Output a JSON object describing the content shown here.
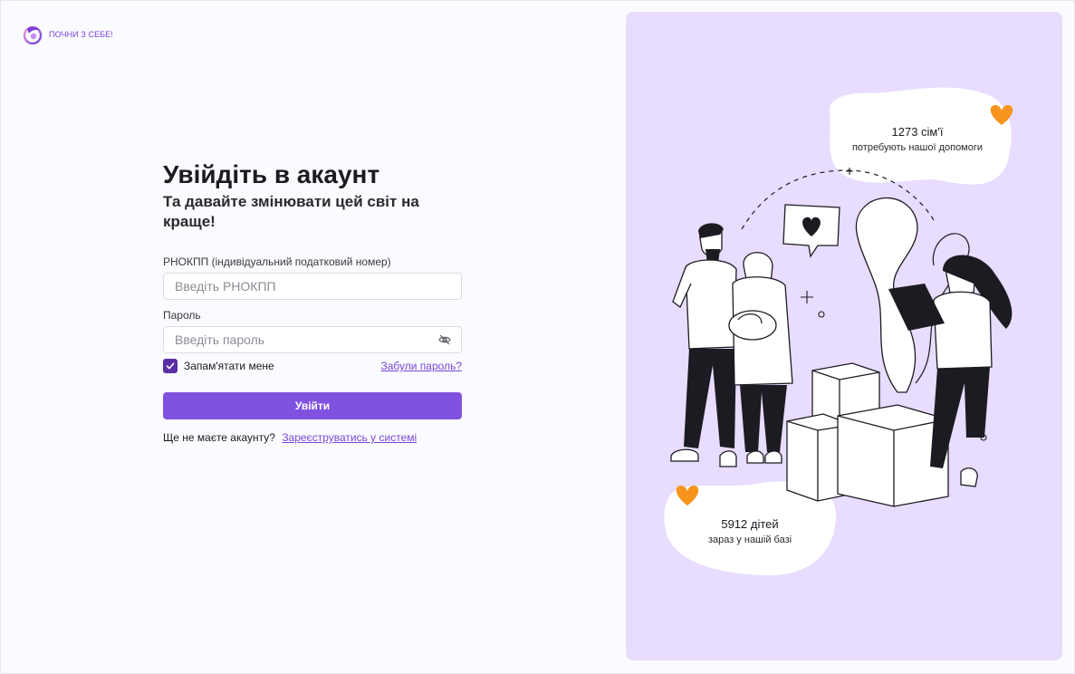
{
  "brand": {
    "logo_text": "ПОЧНИ З СЕБЕ!"
  },
  "login": {
    "title": "Увійдіть в акаунт",
    "subtitle": "Та давайте змінювати цей світ на краще!",
    "tax_label": "РНОКПП (індивідуальний податковий номер)",
    "tax_placeholder": "Введіть РНОКПП",
    "password_label": "Пароль",
    "password_placeholder": "Введіть пароль",
    "remember_label": "Запам'ятати мене",
    "remember_checked": true,
    "forgot_link": "Забули пароль?",
    "submit_label": "Увійти",
    "no_account_text": "Ще не маєте акаунту?",
    "register_link": "Зареєструватись у системі"
  },
  "stats": {
    "families_count": "1273 сім'ї",
    "families_caption": "потребують нашої допомоги",
    "children_count": "5912 дітей",
    "children_caption": "зараз у нашій базі"
  },
  "colors": {
    "accent": "#8151e0",
    "checkbox": "#5b2ea6",
    "panel_bg": "#e8dcff",
    "heart": "#f7941d"
  },
  "icons": [
    "logo-icon",
    "eye-icon",
    "check-icon",
    "orange-heart-icon",
    "heart-bubble-icon"
  ]
}
